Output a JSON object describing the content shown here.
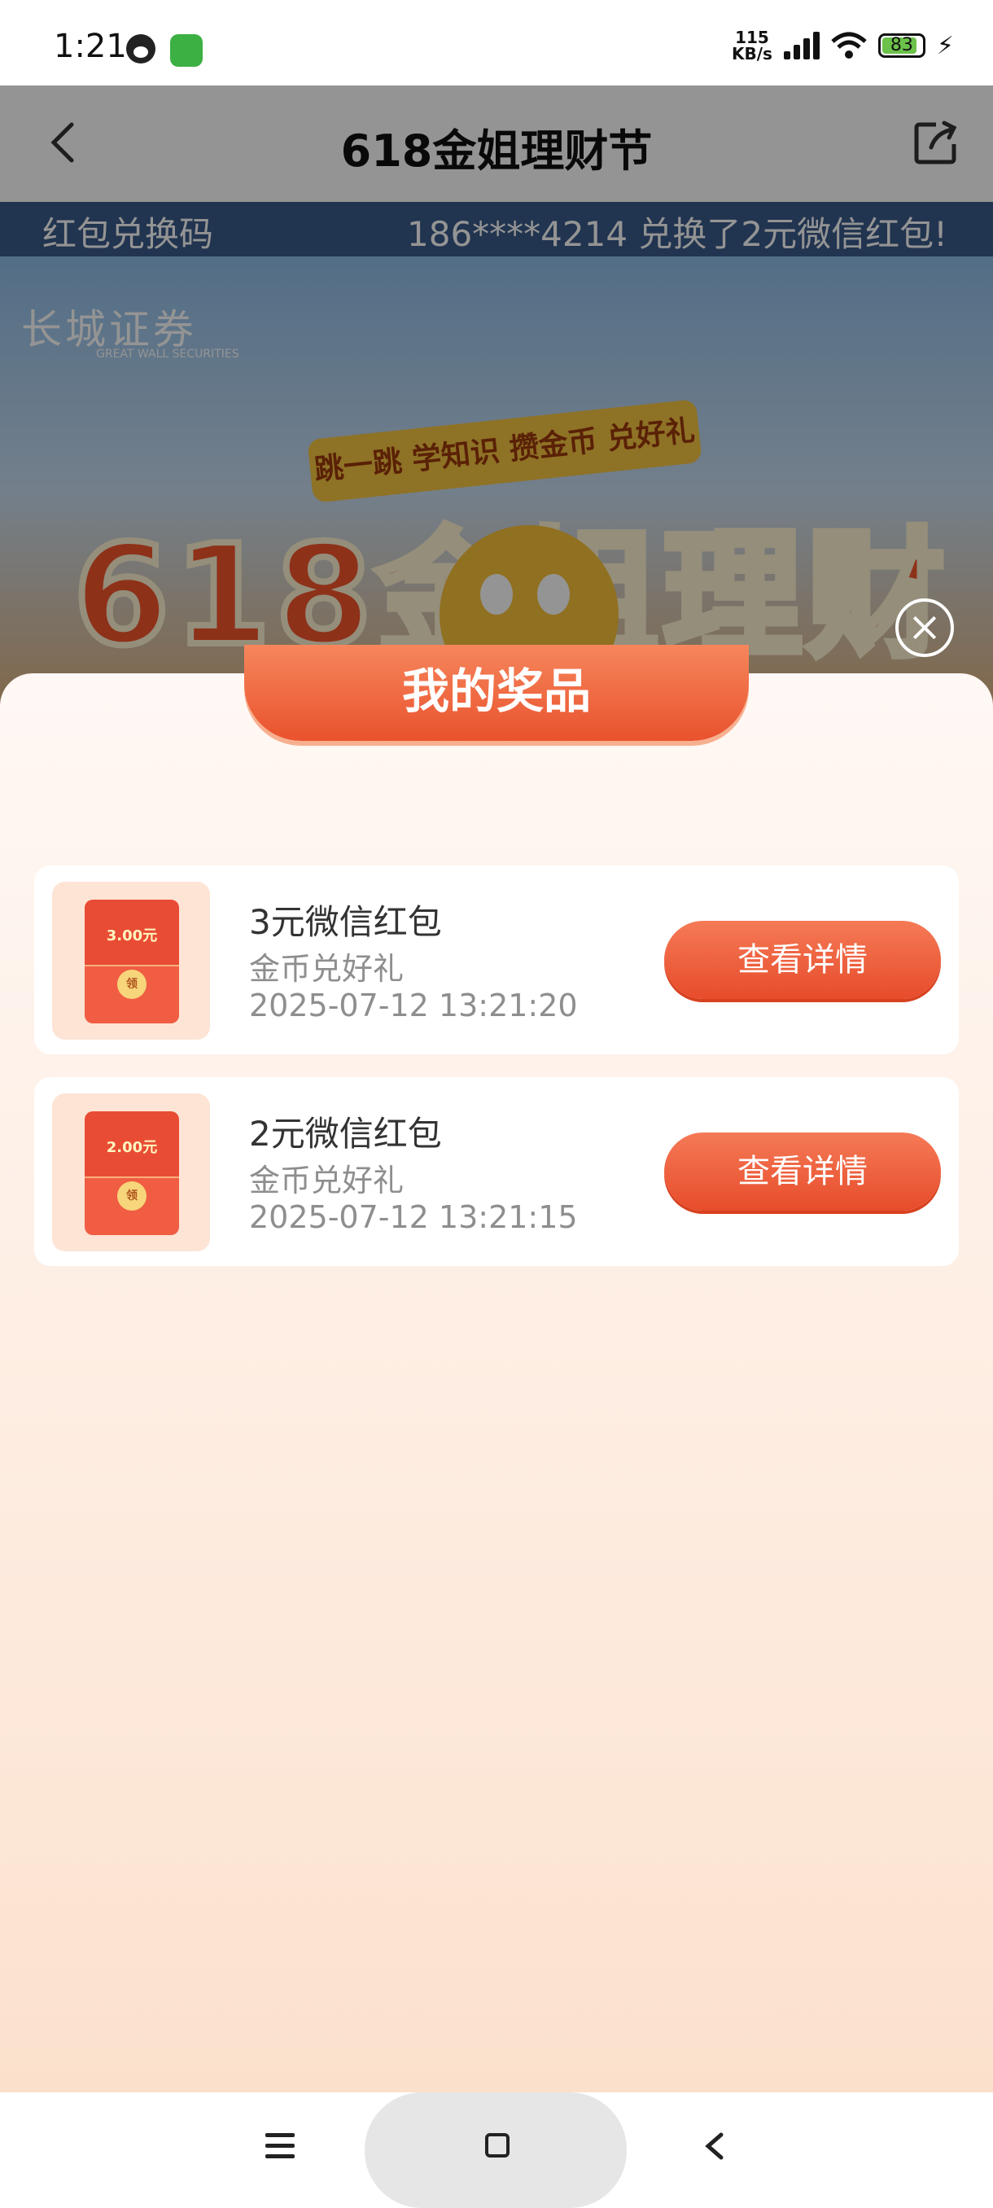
{
  "status_bar": {
    "time": "1:21",
    "net_speed_value": "115",
    "net_speed_unit": "KB/s",
    "battery": "83",
    "icons": [
      "qq-icon",
      "wechat-icon",
      "signal-icon",
      "wifi-icon",
      "battery-icon",
      "charging-icon"
    ]
  },
  "header": {
    "title": "618金姐理财节",
    "back_icon": "chevron-left-icon",
    "share_icon": "share-icon"
  },
  "ticker": {
    "items": [
      "红包兑换码",
      "186****4214 兑换了2元微信红包!"
    ]
  },
  "banner": {
    "brand": "长城证券",
    "brand_en": "GREAT WALL SECURITIES",
    "ribbon": "跳一跳 学知识 攒金币 兑好礼",
    "title": "618金姐理财节"
  },
  "prizes_panel": {
    "title": "我的奖品",
    "close_icon": "close-circle-icon",
    "items": [
      {
        "amount_label": "3.00元",
        "seal": "领",
        "name": "3元微信红包",
        "source": "金币兑好礼",
        "time": "2025-07-12 13:21:20",
        "button": "查看详情"
      },
      {
        "amount_label": "2.00元",
        "seal": "领",
        "name": "2元微信红包",
        "source": "金币兑好礼",
        "time": "2025-07-12 13:21:15",
        "button": "查看详情"
      }
    ]
  },
  "system_nav": {
    "icons": [
      "menu-icon",
      "home-icon",
      "back-icon"
    ]
  },
  "colors": {
    "accent": "#e9522d",
    "sheet_bg": "#fde9db"
  }
}
